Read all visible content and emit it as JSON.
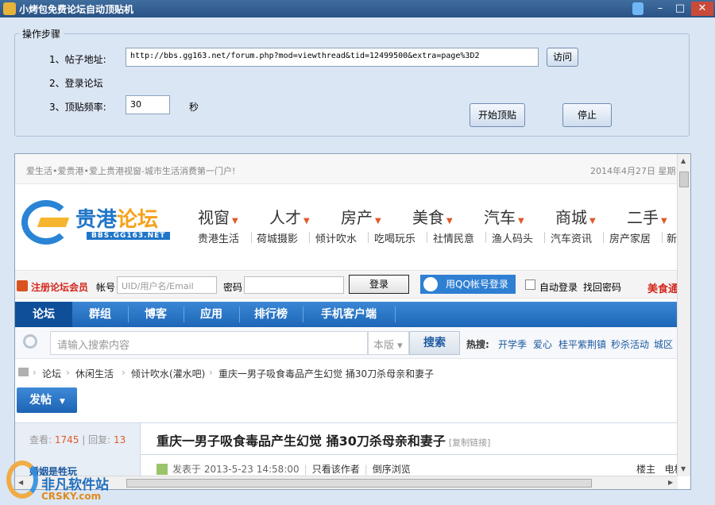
{
  "window": {
    "title": "小烤包免费论坛自动顶贴机",
    "min_glyph": "–",
    "max_glyph": "□",
    "close_glyph": "✕"
  },
  "steps": {
    "legend": "操作步骤",
    "step1_label": "1、帖子地址:",
    "url_value": "http://bbs.gg163.net/forum.php?mod=viewthread&tid=12499500&extra=page%3D2",
    "visit_label": "访问",
    "step2_label": "2、登录论坛",
    "step3_label": "3、顶贴频率:",
    "freq_value": "30",
    "freq_unit": "秒",
    "start_label": "开始顶贴",
    "stop_label": "停止"
  },
  "site": {
    "slogan": "爱生活•爱贵港•爱上贵港视窗-城市生活消费第一门户!",
    "date": "2014年4月27日 星期",
    "logo_name_a": "贵港",
    "logo_name_b": "论坛",
    "logo_url": "BBS.GG163.NET",
    "nav_big": [
      "视窗",
      "人才",
      "房产",
      "美食",
      "汽车",
      "商城",
      "二手"
    ],
    "nav_sub": [
      "贵港生活",
      "荷城摄影",
      "倾计吹水",
      "吃喝玩乐",
      "社情民意",
      "渔人码头",
      "汽车资讯",
      "房产家居",
      "新"
    ],
    "login": {
      "register": "注册论坛会员",
      "account_label": "帐号",
      "account_placeholder": "UID/用户名/Email",
      "password_label": "密码",
      "login_button": "登录",
      "qq_button": "用QQ帐号登录",
      "auto_login": "自动登录",
      "find_password": "找回密码",
      "food": "美食通"
    },
    "main_nav": [
      "论坛",
      "群组",
      "博客",
      "应用",
      "排行榜",
      "手机客户端"
    ],
    "search": {
      "placeholder": "请输入搜索内容",
      "scope": "本版",
      "button": "搜索",
      "hot_label": "热搜:",
      "hot_links": [
        "开学季",
        "爱心",
        "桂平紫荆镇",
        "秒杀活动",
        "城区"
      ]
    },
    "breadcrumb": [
      "论坛",
      "休闲生活",
      "倾计吹水(灌水吧)",
      "重庆一男子吸食毒品产生幻觉 捅30刀杀母亲和妻子"
    ],
    "post_button": "发帖",
    "thread": {
      "views_label": "查看:",
      "views": "1745",
      "replies_label": "回复:",
      "replies": "13",
      "title": "重庆一男子吸食毒品产生幻觉 捅30刀杀母亲和妻子",
      "copy_link": "[复制链接]",
      "author_partial": "婚姻是牲玩",
      "posted_at": "发表于 2013-5-23 14:58:00",
      "only_author": "只看该作者",
      "reverse": "倒序浏览",
      "floor_label": "楼主",
      "floor_extra": "电梯"
    }
  },
  "watermark": {
    "name": "非凡软件站",
    "url": "CRSKY.com"
  }
}
